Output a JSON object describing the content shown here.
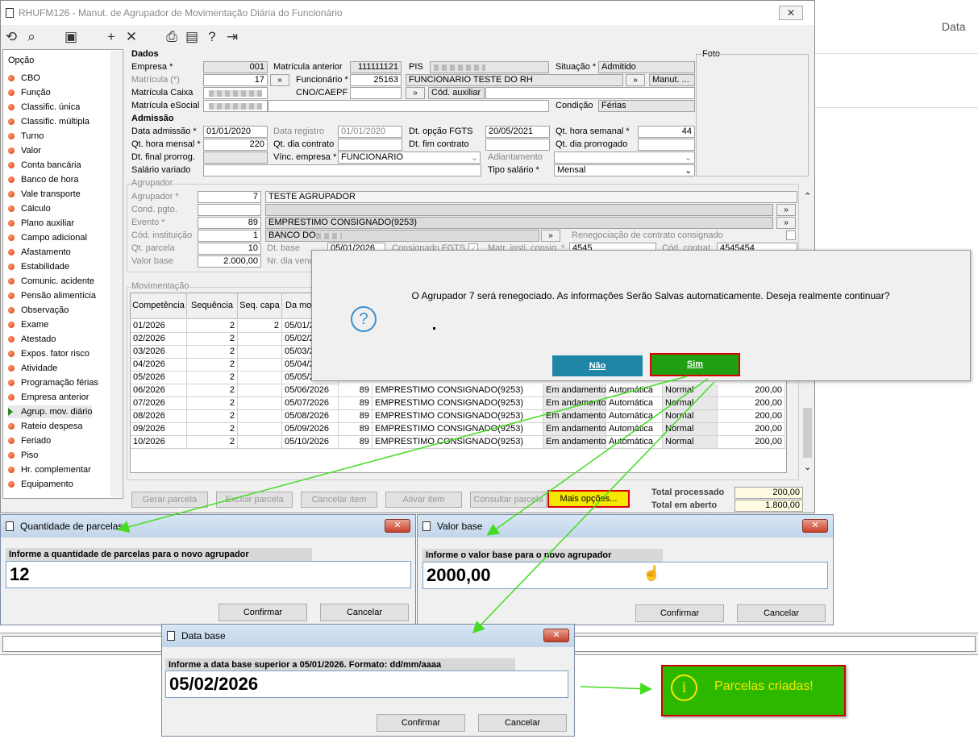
{
  "window": {
    "title": "RHUFM126 - Manut. de Agrupador de Movimentação Diária do Funcionário",
    "close": "✕"
  },
  "background": {
    "data_label": "Data"
  },
  "nav": {
    "header": "Opção",
    "items": [
      "CBO",
      "Função",
      "Classific. única",
      "Classific. múltipla",
      "Turno",
      "Valor",
      "Conta bancária",
      "Banco de hora",
      "Vale transporte",
      "Cálculo",
      "Plano auxiliar",
      "Campo adicional",
      "Afastamento",
      "Estabilidade",
      "Comunic. acidente",
      "Pensão alimentícia",
      "Observação",
      "Exame",
      "Atestado",
      "Expos. fator risco",
      "Atividade",
      "Programação férias",
      "Empresa anterior",
      "Agrup. mov. diário",
      "Rateio despesa",
      "Feriado",
      "Piso",
      "Hr. complementar",
      "Equipamento"
    ]
  },
  "dados": {
    "section": "Dados",
    "foto": "Foto",
    "empresa_lbl": "Empresa *",
    "empresa": "001",
    "mat_ant_lbl": "Matrícula anterior",
    "mat_ant": "111111121",
    "pis_lbl": "PIS",
    "situacao_lbl": "Situação *",
    "situacao": "Admitido",
    "matricula_lbl": "Matrícula (*)",
    "matricula": "17",
    "funcionario_lbl": "Funcionário *",
    "funcionario": "25163",
    "func_nome": "FUNCIONARIO TESTE DO RH",
    "manut": "Manut. ...",
    "mat_caixa_lbl": "Matrícula Caixa",
    "cno_lbl": "CNO/CAEPF",
    "cod_aux": "Cód. auxiliar",
    "mat_esocial_lbl": "Matrícula eSocial",
    "condicao_lbl": "Condição",
    "condicao": "Férias"
  },
  "admissao": {
    "section": "Admissão",
    "dt_adm_lbl": "Data admissão *",
    "dt_adm": "01/01/2020",
    "dt_reg_lbl": "Data registro",
    "dt_reg": "01/01/2020",
    "dt_fgts_lbl": "Dt. opção FGTS",
    "dt_fgts": "20/05/2021",
    "qt_sem_lbl": "Qt. hora semanal *",
    "qt_sem": "44",
    "qt_mens_lbl": "Qt. hora mensal *",
    "qt_mens": "220",
    "qt_contr_lbl": "Qt. dia contrato",
    "dt_fim_lbl": "Dt. fim contrato",
    "qt_prorr_lbl": "Qt. dia prorrogado",
    "dt_final_lbl": "Dt. final prorrog.",
    "vinc_lbl": "Vínc. empresa *",
    "vinc": "FUNCIONARIO",
    "adiant_lbl": "Adiantamento",
    "sal_var_lbl": "Salário variado",
    "tipo_sal_lbl": "Tipo salário *",
    "tipo_sal": "Mensal"
  },
  "agrupador": {
    "section": "Agrupador",
    "agrup_lbl": "Agrupador *",
    "agrup": "7",
    "agrup_nome": "TESTE AGRUPADOR",
    "cond_lbl": "Cond. pgto.",
    "evento_lbl": "Evento *",
    "evento": "89",
    "evento_nome": "EMPRESTIMO CONSIGNADO(9253)",
    "inst_lbl": "Cód. instituição",
    "inst": "1",
    "inst_nome": "BANCO DO",
    "reneg_lbl": "Renegociação de contrato consignado",
    "qt_parc_lbl": "Qt. parcela",
    "qt_parc": "10",
    "dt_base_lbl": "Dt. base",
    "dt_base": "05/01/2026",
    "consig_lbl": "Consignado FGTS",
    "matr_lbl": "Matr. insti. consig. *",
    "matr": "4545",
    "cod_contr_lbl": "Cód. contrat.",
    "cod_contr": "4545454",
    "valor_lbl": "Valor base",
    "valor": "2.000,00",
    "nr_dia_lbl": "Nr. dia venc"
  },
  "movimentacao": {
    "section": "Movimentação",
    "headers": [
      "Competência",
      "Sequência",
      "Seq. capa",
      "Da movim"
    ],
    "rows": [
      [
        "01/2026",
        "2",
        "2",
        "05/01/2"
      ],
      [
        "02/2026",
        "2",
        "",
        "05/02/2"
      ],
      [
        "03/2026",
        "2",
        "",
        "05/03/2"
      ],
      [
        "04/2026",
        "2",
        "",
        "05/04/2"
      ],
      [
        "05/2026",
        "2",
        "",
        "05/05/2"
      ],
      [
        "06/2026",
        "2",
        "",
        "05/06/2026",
        "89",
        "EMPRESTIMO CONSIGNADO(9253)",
        "Em andamento",
        "Automática",
        "Normal",
        "200,00"
      ],
      [
        "07/2026",
        "2",
        "",
        "05/07/2026",
        "89",
        "EMPRESTIMO CONSIGNADO(9253)",
        "Em andamento",
        "Automática",
        "Normal",
        "200,00"
      ],
      [
        "08/2026",
        "2",
        "",
        "05/08/2026",
        "89",
        "EMPRESTIMO CONSIGNADO(9253)",
        "Em andamento",
        "Automática",
        "Normal",
        "200,00"
      ],
      [
        "09/2026",
        "2",
        "",
        "05/09/2026",
        "89",
        "EMPRESTIMO CONSIGNADO(9253)",
        "Em andamento",
        "Automática",
        "Normal",
        "200,00"
      ],
      [
        "10/2026",
        "2",
        "",
        "05/10/2026",
        "89",
        "EMPRESTIMO CONSIGNADO(9253)",
        "Em andamento",
        "Automática",
        "Normal",
        "200,00"
      ]
    ]
  },
  "actions": {
    "gerar": "Gerar parcela",
    "excluir": "Excluir parcela",
    "cancelar": "Cancelar item",
    "ativar": "Ativar item",
    "consultar": "Consultar parcela",
    "mais": "Mais opções...",
    "total_proc_lbl": "Total processado",
    "total_proc": "200,00",
    "total_aberto_lbl": "Total em aberto",
    "total_aberto": "1.800,00"
  },
  "confirm": {
    "message": "O Agrupador 7 será renegociado. As informações Serão Salvas automaticamente. Deseja realmente continuar?",
    "nao": "Não",
    "sim": "Sim"
  },
  "dlg_qtd": {
    "title": "Quantidade de parcelas",
    "label": "Informe a quantidade de parcelas para o novo agrupador",
    "value": "12",
    "confirm": "Confirmar",
    "cancel": "Cancelar"
  },
  "dlg_valor": {
    "title": "Valor base",
    "label": "Informe o valor base para o novo agrupador",
    "value": "2000,00",
    "confirm": "Confirmar",
    "cancel": "Cancelar"
  },
  "dlg_data": {
    "title": "Data base",
    "label": "Informe a data base superior a 05/01/2026. Formato: dd/mm/aaaa",
    "value": "05/02/2026",
    "confirm": "Confirmar",
    "cancel": "Cancelar"
  },
  "toast": {
    "message": "Parcelas criadas!"
  },
  "colors": {
    "accent_green": "#2db800",
    "nao_blue": "#1f86a8",
    "arrow_green": "#44dd22"
  }
}
